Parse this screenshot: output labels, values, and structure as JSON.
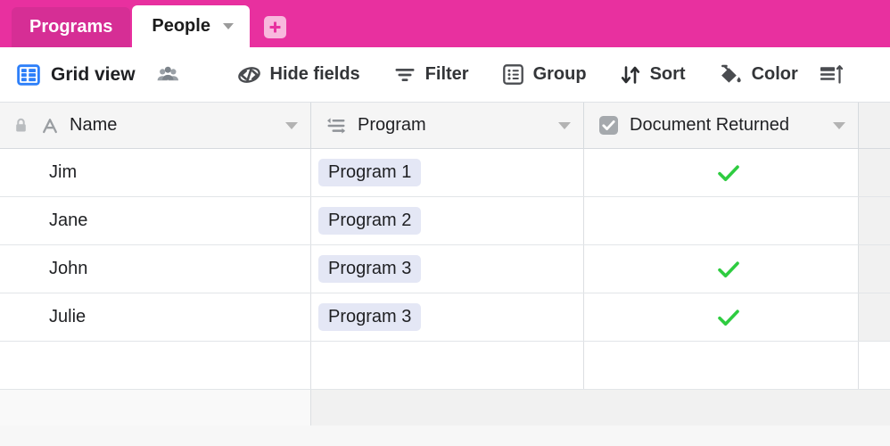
{
  "tabs": {
    "items": [
      {
        "label": "Programs",
        "active": false,
        "icon": ""
      },
      {
        "label": "People",
        "active": true,
        "icon": "chevron-down-icon"
      }
    ],
    "add_label": "+",
    "add_icon": "plus-icon",
    "bar_color": "#e8309f",
    "inactive_tab_color": "#d62e95",
    "add_button_color": "#f8b8dd"
  },
  "toolbar": {
    "view_name": "Grid view",
    "view_icon": "grid-view-icon",
    "view_icon_color": "#2d7ff9",
    "collaborators_icon": "people-icon",
    "buttons": [
      {
        "label": "Hide fields",
        "icon": "hide-fields-icon"
      },
      {
        "label": "Filter",
        "icon": "filter-icon"
      },
      {
        "label": "Group",
        "icon": "group-icon"
      },
      {
        "label": "Sort",
        "icon": "sort-icon"
      },
      {
        "label": "Color",
        "icon": "color-paint-bucket-icon"
      }
    ],
    "row_height_icon": "row-height-icon"
  },
  "grid": {
    "columns": [
      {
        "name": "Name",
        "icon": "text-field-icon",
        "locked": true,
        "lock_icon": "lock-icon",
        "caret": "chevron-down-icon"
      },
      {
        "name": "Program",
        "icon": "single-select-icon",
        "locked": false,
        "caret": "chevron-down-icon"
      },
      {
        "name": "Document Returned",
        "icon": "checkbox-field-icon",
        "locked": false,
        "caret": "chevron-down-icon"
      }
    ],
    "rows": [
      {
        "name": "Jim",
        "program": "Program 1",
        "document_returned": true
      },
      {
        "name": "Jane",
        "program": "Program 2",
        "document_returned": false
      },
      {
        "name": "John",
        "program": "Program 3",
        "document_returned": true
      },
      {
        "name": "Julie",
        "program": "Program 3",
        "document_returned": true
      },
      {
        "name": "",
        "program": "",
        "document_returned": false
      }
    ],
    "check_color": "#2ecc40",
    "tag_background": "#e4e7f5"
  }
}
